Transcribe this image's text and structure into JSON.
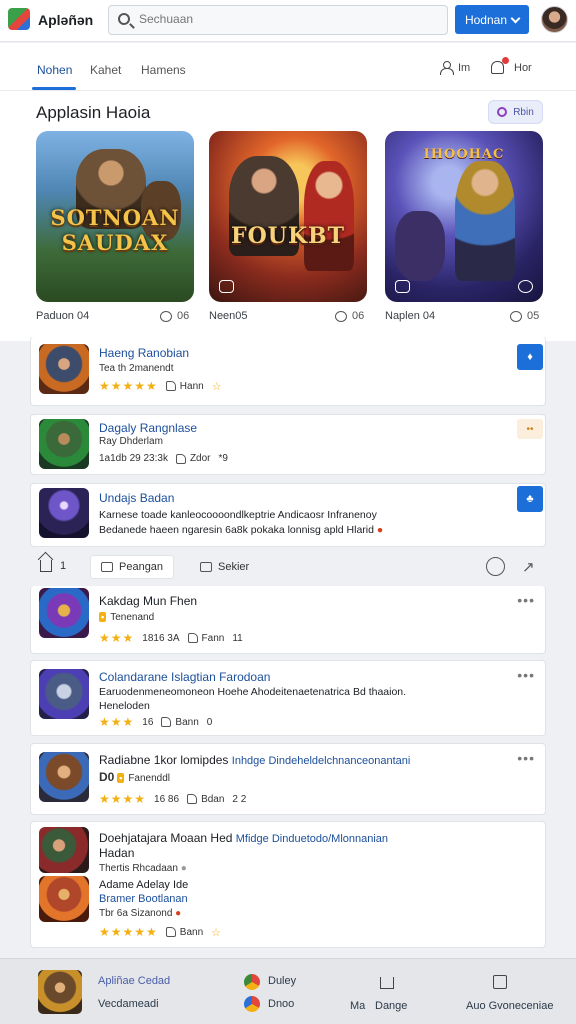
{
  "header": {
    "app_name": "Apləñən",
    "search_placeholder": "Sechuaan",
    "primary_button": "Hodnan"
  },
  "tabs": [
    {
      "label": "Nohen",
      "active": true
    },
    {
      "label": "Kahet",
      "active": false
    },
    {
      "label": "Hamens",
      "active": false
    }
  ],
  "header_actions": {
    "profile_label": "Im",
    "notifications_label": "Hor"
  },
  "section": {
    "title": "Applasin Haoia",
    "action_label": "Rbin"
  },
  "featured": [
    {
      "art_title": "SOTNOAN SAUDAX",
      "author": "Paduon 04",
      "count": "06"
    },
    {
      "art_title": "FOUKBT",
      "author": "Neen05",
      "count": "06"
    },
    {
      "art_title": "IHOOHAC",
      "author": "Naplen 04",
      "count": "05"
    }
  ],
  "list_top": [
    {
      "title": "Haeng Ranobian",
      "sub": "Tea th 2manendt",
      "rating": 5,
      "likes": "Hann",
      "action_icon": "bookmark-icon"
    },
    {
      "title": "Dagaly Rangnlase",
      "sub": "Ray Dhderlam",
      "meta": "1a1db 29 23:3k",
      "likes": "Zdor",
      "extra": "*9",
      "action_icon": "tag-icon"
    },
    {
      "title": "Undajs Badan",
      "desc1": "Karnese toade kanleocoooondlkeptrie Andicaosr Infranenoy",
      "desc2": "Bedanede haeen ngaresin 6a8k pokaka lonnisg apld Hlarid",
      "action_icon": "group-icon"
    }
  ],
  "strip": {
    "home_count": "1",
    "chip1": "Peangan",
    "chip2": "Sekier"
  },
  "list_bottom": [
    {
      "title": "Kakdag Mun Fhen",
      "sub": "Tenenand",
      "rating": 3,
      "meta": "1816 3A",
      "likes": "Fann",
      "extra": "11"
    },
    {
      "title": "Colandarane Islagtian Farodoan",
      "desc1": "Earuodenmeneomoneon Hoehe Ahodeitenaetenatrica Bd thaaion.",
      "desc2": "Heneloden",
      "rating": 3,
      "meta": "16",
      "likes": "Bann",
      "extra": "0"
    },
    {
      "title": "Radiabne 1kor lomipdes",
      "title_link": "Inhdge Dindeheldelchnanceonantani",
      "sub_prefix": "D0",
      "sub": "Fanenddl",
      "rating": 4,
      "meta": "16 86",
      "likes": "Bdan",
      "extra": "2 2"
    },
    {
      "title": "Doehjatajara Moaan Hed",
      "title_link": "Mfidge Dinduetodo/Mlonnanian",
      "sub": "Hadan",
      "line2": "Thertis Rhcadaan",
      "title2": "Adame Adelay Ide",
      "sub2": "Bramer Bootlanan",
      "line4": "Tbr 6a Sizanond",
      "rating": 5,
      "likes": "Bann"
    }
  ],
  "bottom_bar": {
    "title": "Apliñae Cedad",
    "subtitle": "Vecdameadi",
    "item1": "Duley",
    "item2": "Dnoo",
    "nav1": "Ma",
    "nav2": "Dange",
    "nav3": "Auo Gvoneceniae"
  },
  "colors": {
    "accent": "#1c6fd9",
    "star": "#f3b013",
    "link": "#1c4f9c"
  }
}
